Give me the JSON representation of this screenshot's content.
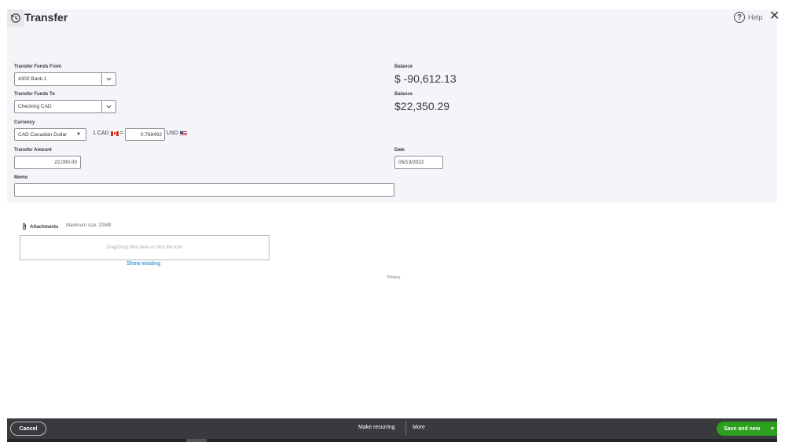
{
  "header": {
    "title": "Transfer",
    "help_label": "Help",
    "close_icon": "close-icon",
    "logo_icon": "transfer-history-icon"
  },
  "form": {
    "from_label": "Transfer Funds From",
    "from_value": "4300 Bank.1",
    "to_label": "Transfer Funds To",
    "to_value": "Checking CAD",
    "currency_label": "Currency",
    "currency_value": "CAD Canadian Dollar",
    "rate_prefix": "1 CAD",
    "rate_equals": "=",
    "rate_value": "0.768492",
    "rate_suffix": "USD",
    "amount_label": "Transfer Amount",
    "amount_value": "22,000.00",
    "memo_label": "Memo",
    "memo_value": "",
    "from_balance_label": "Balance",
    "from_balance_value": "$ -90,612.13",
    "to_balance_label": "Balance",
    "to_balance_value": "$22,350.29",
    "date_label": "Date",
    "date_value": "05/13/2022"
  },
  "attachments": {
    "label": "Attachments",
    "max_size": "Maximum size: 20MB",
    "drop_text": "Drag/Drop files here or click the icon",
    "show_existing": "Show existing"
  },
  "privacy": "Privacy",
  "footer": {
    "cancel": "Cancel",
    "make_recurring": "Make recurring",
    "more": "More",
    "save_and_new": "Save and new"
  },
  "colors": {
    "accent_green": "#2ca01c",
    "footer_bg": "#393a3d",
    "link_blue": "#0077c5",
    "panel_bg": "#f4f5f8"
  }
}
